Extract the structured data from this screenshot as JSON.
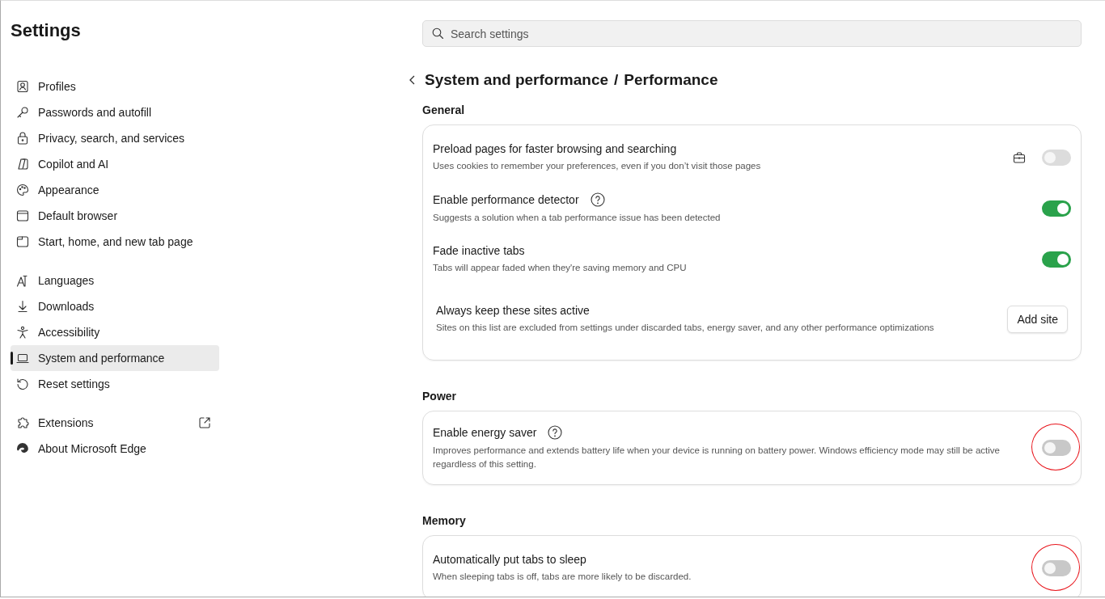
{
  "sidebar": {
    "title": "Settings",
    "groups": [
      {
        "items": [
          {
            "label": "Profiles",
            "selected": false
          },
          {
            "label": "Passwords and autofill",
            "selected": false
          },
          {
            "label": "Privacy, search, and services",
            "selected": false
          },
          {
            "label": "Copilot and AI",
            "selected": false
          },
          {
            "label": "Appearance",
            "selected": false
          },
          {
            "label": "Default browser",
            "selected": false
          },
          {
            "label": "Start, home, and new tab page",
            "selected": false
          }
        ]
      },
      {
        "items": [
          {
            "label": "Languages",
            "selected": false
          },
          {
            "label": "Downloads",
            "selected": false
          },
          {
            "label": "Accessibility",
            "selected": false
          },
          {
            "label": "System and performance",
            "selected": true
          },
          {
            "label": "Reset settings",
            "selected": false
          }
        ]
      },
      {
        "items": [
          {
            "label": "Extensions",
            "selected": false,
            "external": true
          },
          {
            "label": "About Microsoft Edge",
            "selected": false,
            "external": false
          }
        ]
      }
    ]
  },
  "search": {
    "placeholder": "Search settings"
  },
  "breadcrumb": {
    "parent": "System and performance",
    "separator": "/",
    "current": "Performance"
  },
  "sections": [
    {
      "heading": "General",
      "rows": [
        {
          "kind": "toggle",
          "title": "Preload pages for faster browsing and searching",
          "description": "Uses cookies to remember your preferences, even if you don’t visit those pages",
          "help": false,
          "managed": true,
          "on": false,
          "disabled": true,
          "highlighted": false
        },
        {
          "kind": "toggle",
          "title": "Enable performance detector",
          "description": "Suggests a solution when a tab performance issue has been detected",
          "help": true,
          "managed": false,
          "on": true,
          "disabled": false,
          "highlighted": false
        },
        {
          "kind": "toggle",
          "title": "Fade inactive tabs",
          "description": "Tabs will appear faded when they're saving memory and CPU",
          "help": false,
          "managed": false,
          "on": true,
          "disabled": false,
          "highlighted": false
        },
        {
          "kind": "button",
          "title": "Always keep these sites active",
          "description": "Sites on this list are excluded from settings under discarded tabs, energy saver, and any other performance optimizations",
          "button": "Add site"
        }
      ]
    },
    {
      "heading": "Power",
      "rows": [
        {
          "kind": "toggle",
          "title": "Enable energy saver",
          "description": "Improves performance and extends battery life when your device is running on battery power. Windows efficiency mode may still be active regardless of this setting.",
          "help": true,
          "managed": false,
          "on": false,
          "disabled": false,
          "highlighted": true
        }
      ]
    },
    {
      "heading": "Memory",
      "rows": [
        {
          "kind": "toggle",
          "title": "Automatically put tabs to sleep",
          "description": "When sleeping tabs is off, tabs are more likely to be discarded.",
          "help": false,
          "managed": false,
          "on": false,
          "disabled": false,
          "highlighted": true
        }
      ]
    }
  ]
}
